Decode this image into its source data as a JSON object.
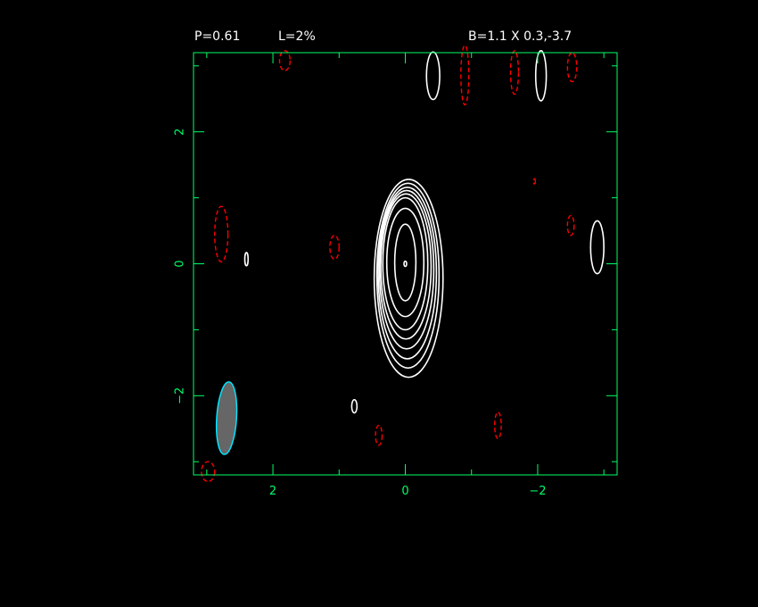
{
  "header": {
    "peak": "P=0.61",
    "level": "L=2%",
    "beam": "B=1.1 X 0.3,-3.7"
  },
  "chart_data": {
    "type": "contour",
    "title": "",
    "xlabel": "",
    "ylabel": "",
    "xlim": [
      3.2,
      -3.2
    ],
    "ylim": [
      -3.2,
      3.2
    ],
    "x_ticks": [
      {
        "value": 2,
        "label": "2"
      },
      {
        "value": 0,
        "label": "0"
      },
      {
        "value": -2,
        "label": "−2"
      }
    ],
    "y_ticks": [
      {
        "value": 2,
        "label": "2"
      },
      {
        "value": 0,
        "label": "0"
      },
      {
        "value": -2,
        "label": "−2"
      }
    ],
    "colors": {
      "axes": "#00ff66",
      "positive_contour": "#ffffff",
      "negative_contour": "#ff0000",
      "beam_edge": "#00e5ff",
      "beam_fill": "#666666"
    },
    "positive_contours": [
      {
        "cx": -0.05,
        "cy": -0.22,
        "rx": 0.52,
        "ry": 1.5
      },
      {
        "cx": -0.04,
        "cy": -0.18,
        "rx": 0.47,
        "ry": 1.4
      },
      {
        "cx": -0.03,
        "cy": -0.14,
        "rx": 0.44,
        "ry": 1.3
      },
      {
        "cx": -0.02,
        "cy": -0.09,
        "rx": 0.41,
        "ry": 1.2
      },
      {
        "cx": -0.01,
        "cy": -0.04,
        "rx": 0.38,
        "ry": 1.1
      },
      {
        "cx": 0.0,
        "cy": 0.0,
        "rx": 0.34,
        "ry": 1.0
      },
      {
        "cx": 0.0,
        "cy": 0.02,
        "rx": 0.28,
        "ry": 0.82
      },
      {
        "cx": 0.0,
        "cy": 0.02,
        "rx": 0.16,
        "ry": 0.58
      },
      {
        "cx": 0.0,
        "cy": 0.0,
        "rx": 0.02,
        "ry": 0.04
      },
      {
        "cx": -0.42,
        "cy": 2.85,
        "rx": 0.1,
        "ry": 0.36
      },
      {
        "cx": -2.05,
        "cy": 2.85,
        "rx": 0.08,
        "ry": 0.38
      },
      {
        "cx": -2.9,
        "cy": 0.25,
        "rx": 0.1,
        "ry": 0.4
      },
      {
        "cx": 2.4,
        "cy": 0.07,
        "rx": 0.025,
        "ry": 0.1
      },
      {
        "cx": 0.77,
        "cy": -2.16,
        "rx": 0.04,
        "ry": 0.1
      }
    ],
    "negative_contours": [
      {
        "cx": 2.78,
        "cy": 0.45,
        "rx": 0.1,
        "ry": 0.42
      },
      {
        "cx": 1.07,
        "cy": 0.25,
        "rx": 0.07,
        "ry": 0.18
      },
      {
        "cx": 1.82,
        "cy": 3.08,
        "rx": 0.08,
        "ry": 0.15
      },
      {
        "cx": -0.9,
        "cy": 2.86,
        "rx": 0.06,
        "ry": 0.45
      },
      {
        "cx": -1.65,
        "cy": 2.9,
        "rx": 0.06,
        "ry": 0.33
      },
      {
        "cx": -2.52,
        "cy": 2.98,
        "rx": 0.07,
        "ry": 0.22
      },
      {
        "cx": -2.5,
        "cy": 0.58,
        "rx": 0.05,
        "ry": 0.15
      },
      {
        "cx": -1.95,
        "cy": 1.25,
        "rx": 0.015,
        "ry": 0.04
      },
      {
        "cx": 0.4,
        "cy": -2.6,
        "rx": 0.05,
        "ry": 0.15
      },
      {
        "cx": -1.4,
        "cy": -2.45,
        "rx": 0.05,
        "ry": 0.2
      },
      {
        "cx": 2.98,
        "cy": -3.15,
        "rx": 0.1,
        "ry": 0.15
      }
    ],
    "beam": {
      "cx": 2.7,
      "cy": -2.34,
      "major": 1.1,
      "minor": 0.3,
      "pa": -3.7
    }
  }
}
